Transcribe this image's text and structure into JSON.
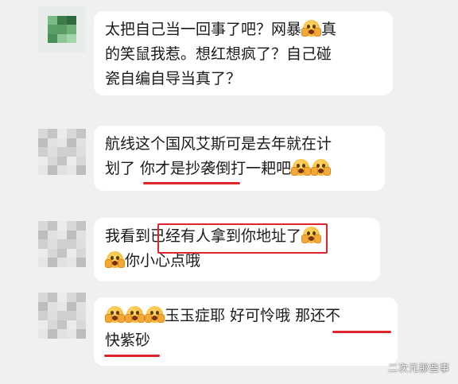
{
  "messages": [
    {
      "avatar": "avatar-green-blurred",
      "lines": [
        [
          {
            "t": "text",
            "v": "太把自己当一回事了吧？网暴"
          },
          {
            "t": "emoji",
            "v": "face-hand-over-mouth"
          },
          {
            "t": "text",
            "v": "真"
          }
        ],
        [
          {
            "t": "text",
            "v": "的笑鼠我惹。想红想疯了？自己碰"
          }
        ],
        [
          {
            "t": "text",
            "v": "瓷自编自导当真了？"
          }
        ]
      ]
    },
    {
      "avatar": "avatar-gray-blurred",
      "lines": [
        [
          {
            "t": "text",
            "v": "航线这个国风艾斯可是去年就在计"
          }
        ],
        [
          {
            "t": "text",
            "v": "划了 "
          },
          {
            "t": "text",
            "v": "你才是抄袭"
          },
          {
            "t": "text",
            "v": "倒打一耙吧"
          },
          {
            "t": "emoji",
            "v": "face-screaming"
          },
          {
            "t": "emoji",
            "v": "face-screaming"
          }
        ]
      ]
    },
    {
      "avatar": "avatar-gray-blurred",
      "lines": [
        [
          {
            "t": "text",
            "v": "我看到"
          },
          {
            "t": "text",
            "v": "已经有人拿到你地址"
          },
          {
            "t": "text",
            "v": "了"
          },
          {
            "t": "emoji",
            "v": "face-screaming"
          }
        ],
        [
          {
            "t": "emoji",
            "v": "face-screaming"
          },
          {
            "t": "text",
            "v": "你小心点哦"
          }
        ]
      ]
    },
    {
      "avatar": "avatar-gray-blurred",
      "lines": [
        [
          {
            "t": "emoji",
            "v": "face-screaming"
          },
          {
            "t": "emoji",
            "v": "face-screaming"
          },
          {
            "t": "emoji",
            "v": "face-screaming"
          },
          {
            "t": "text",
            "v": "玉玉症耶 好可怜哦 那"
          },
          {
            "t": "text",
            "v": "还不"
          }
        ],
        [
          {
            "t": "text",
            "v": "快紫砂"
          }
        ]
      ]
    }
  ],
  "watermark": "二次元那些事",
  "colors": {
    "background": "#f0f0f0",
    "bubble": "#ffffff",
    "annotation_red": "#e0242b"
  }
}
